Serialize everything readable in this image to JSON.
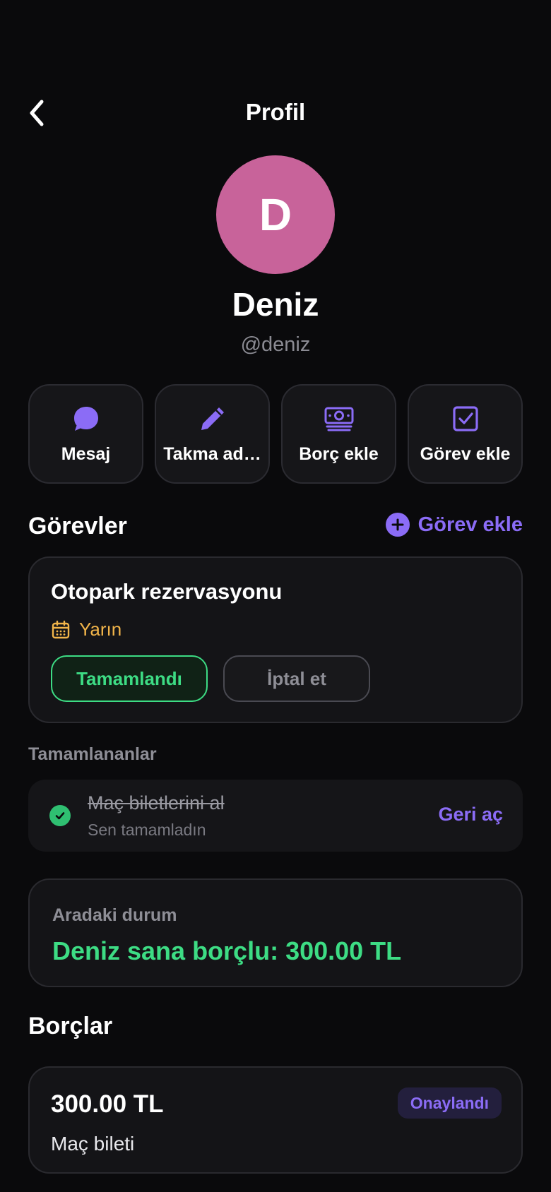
{
  "header": {
    "title": "Profil"
  },
  "profile": {
    "initial": "D",
    "name": "Deniz",
    "handle": "@deniz",
    "avatar_color": "#c8639a"
  },
  "actions": [
    {
      "label": "Mesaj",
      "icon": "chat-bubble-icon"
    },
    {
      "label": "Takma ad…",
      "icon": "pencil-icon"
    },
    {
      "label": "Borç ekle",
      "icon": "money-icon"
    },
    {
      "label": "Görev ekle",
      "icon": "checkbox-icon"
    }
  ],
  "tasks": {
    "title": "Görevler",
    "add_label": "Görev ekle",
    "active": {
      "title": "Otopark rezervasyonu",
      "due": "Yarın",
      "done_label": "Tamamlandı",
      "cancel_label": "İptal et"
    },
    "completed_title": "Tamamlananlar",
    "completed": {
      "title": "Maç biletlerini al",
      "subtitle": "Sen tamamladın",
      "reopen_label": "Geri aç"
    }
  },
  "balance": {
    "label": "Aradaki durum",
    "value": "Deniz sana borçlu: 300.00 TL"
  },
  "debts": {
    "title": "Borçlar",
    "items": [
      {
        "amount": "300.00 TL",
        "status": "Onaylandı",
        "description": "Maç bileti"
      }
    ]
  },
  "colors": {
    "accent": "#8b6cf6",
    "success": "#3ddc84",
    "warning": "#f2b54a",
    "background": "#0a0a0c",
    "card": "#141417"
  }
}
